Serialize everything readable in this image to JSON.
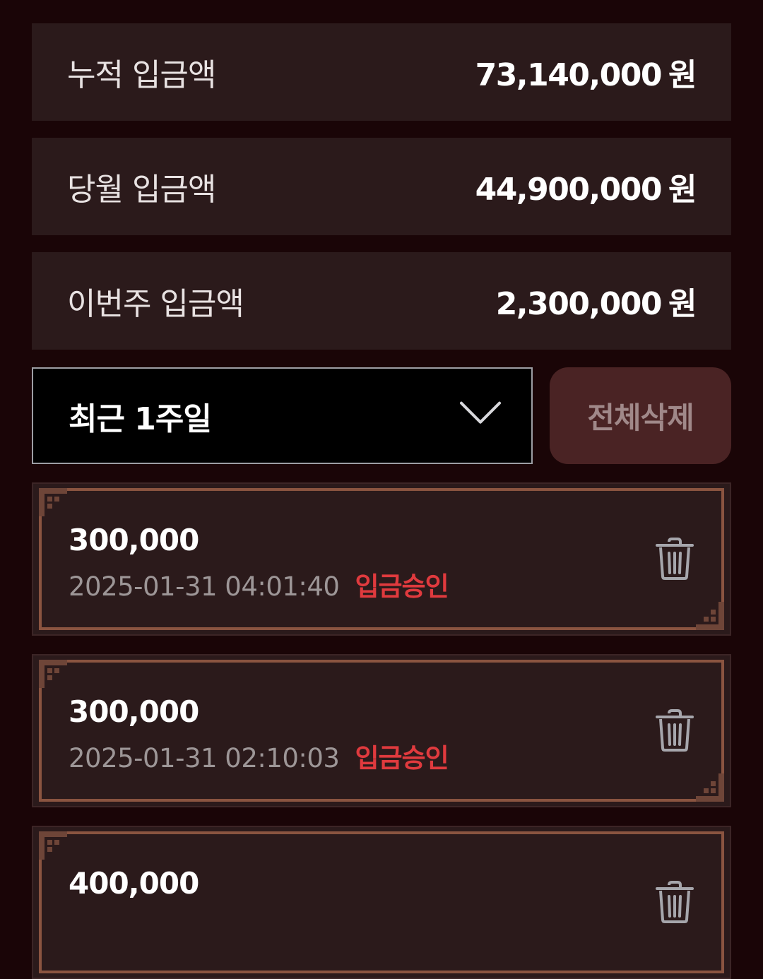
{
  "summary": [
    {
      "label": "누적 입금액",
      "amount": "73,140,000",
      "unit": "원"
    },
    {
      "label": "당월 입금액",
      "amount": "44,900,000",
      "unit": "원"
    },
    {
      "label": "이번주 입금액",
      "amount": "2,300,000",
      "unit": "원"
    }
  ],
  "filter": {
    "selected": "최근 1주일",
    "icon": "chevron-down-icon"
  },
  "delete_all_label": "전체삭제",
  "deposits": [
    {
      "amount": "300,000",
      "datetime": "2025-01-31 04:01:40",
      "status": "입금승인"
    },
    {
      "amount": "300,000",
      "datetime": "2025-01-31 02:10:03",
      "status": "입금승인"
    },
    {
      "amount": "400,000",
      "datetime": "",
      "status": ""
    }
  ],
  "colors": {
    "background": "#1a0507",
    "panel": "#2b1a1b",
    "frame": "#8a5440",
    "status_red": "#e03a3e",
    "delete_all_bg": "#4a2324"
  }
}
